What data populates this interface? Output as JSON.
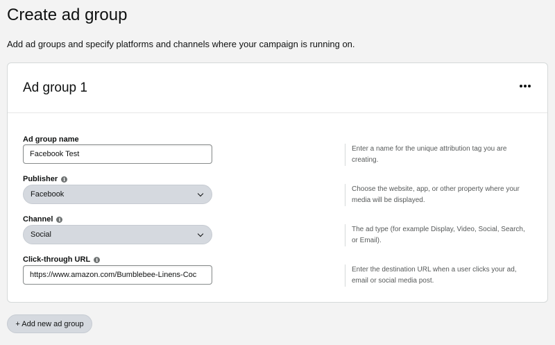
{
  "page": {
    "title": "Create ad group",
    "subtitle": "Add ad groups and specify platforms and channels where your campaign is running on."
  },
  "ad_group": {
    "title": "Ad group 1",
    "more_icon": "more-horizontal-icon",
    "fields": {
      "name": {
        "label": "Ad group name",
        "value": "Facebook Test",
        "help": "Enter a name for the unique attribution tag you are creating."
      },
      "publisher": {
        "label": "Publisher",
        "value": "Facebook",
        "help": "Choose the website, app, or other property where your media will be displayed."
      },
      "channel": {
        "label": "Channel",
        "value": "Social",
        "help": "The ad type (for example Display, Video, Social, Search, or Email)."
      },
      "url": {
        "label": "Click-through URL",
        "value": "https://www.amazon.com/Bumblebee-Linens-Coc",
        "help": "Enter the destination URL when a user clicks your ad, email or social media post."
      }
    }
  },
  "actions": {
    "add_label": "+ Add new ad group"
  },
  "colors": {
    "background": "#f3f3f3",
    "card": "#ffffff",
    "pill": "#d5d9df",
    "help_text": "#565959"
  }
}
